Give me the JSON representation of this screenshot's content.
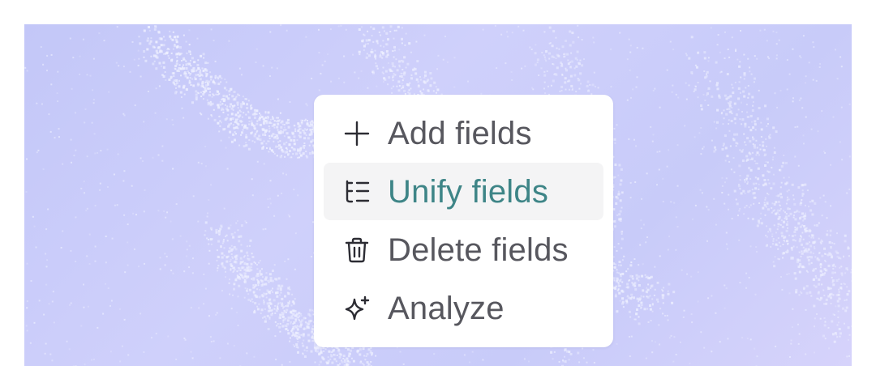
{
  "colors": {
    "background_gradient_start": "#c3c7f8",
    "background_gradient_end": "#d6d3fb",
    "menu_background": "#ffffff",
    "item_text": "#57575e",
    "active_item_text": "#3e8587",
    "active_item_background": "#f4f4f5",
    "icon_color": "#2c2c33"
  },
  "menu": {
    "items": [
      {
        "label": "Add fields",
        "icon": "plus-icon",
        "active": false
      },
      {
        "label": "Unify fields",
        "icon": "list-tree-icon",
        "active": true
      },
      {
        "label": "Delete fields",
        "icon": "trash-icon",
        "active": false
      },
      {
        "label": "Analyze",
        "icon": "sparkles-icon",
        "active": false
      }
    ]
  }
}
